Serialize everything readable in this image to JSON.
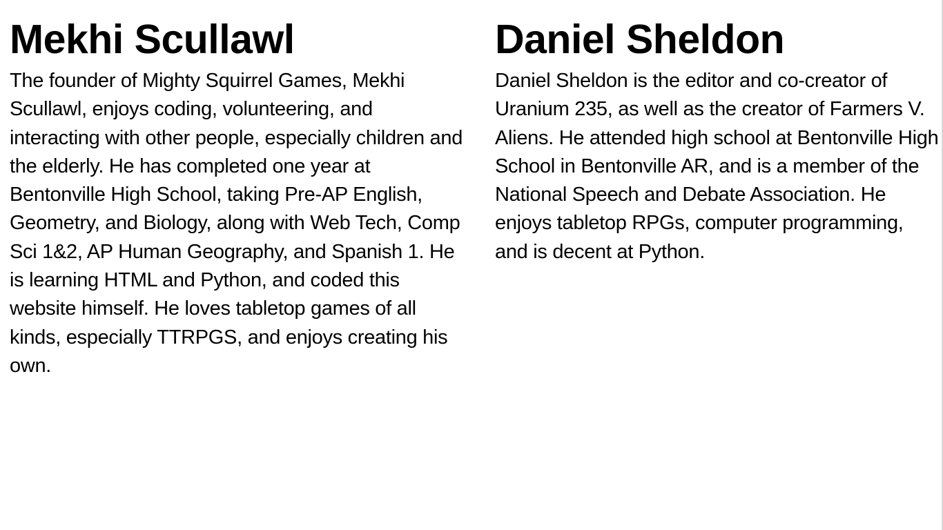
{
  "people": [
    {
      "name": "Mekhi Scullawl",
      "bio": "The founder of Mighty Squirrel Games, Mekhi Scullawl, enjoys coding, volunteering, and interacting with other people, especially children and the elderly. He has completed one year at Bentonville High School, taking Pre-AP English, Geometry, and Biology, along with Web Tech, Comp Sci 1&2, AP Human Geography, and Spanish 1. He is learning HTML and Python, and coded this website himself. He loves tabletop games of all kinds, especially TTRPGS, and enjoys creating his own."
    },
    {
      "name": "Daniel Sheldon",
      "bio": "Daniel Sheldon is the editor and co-creator of Uranium 235, as well as the creator of Farmers V. Aliens. He attended high school at Bentonville High School in Bentonville AR, and is a member of the National Speech and Debate Association. He enjoys tabletop RPGs, computer programming, and is decent at Python."
    }
  ]
}
